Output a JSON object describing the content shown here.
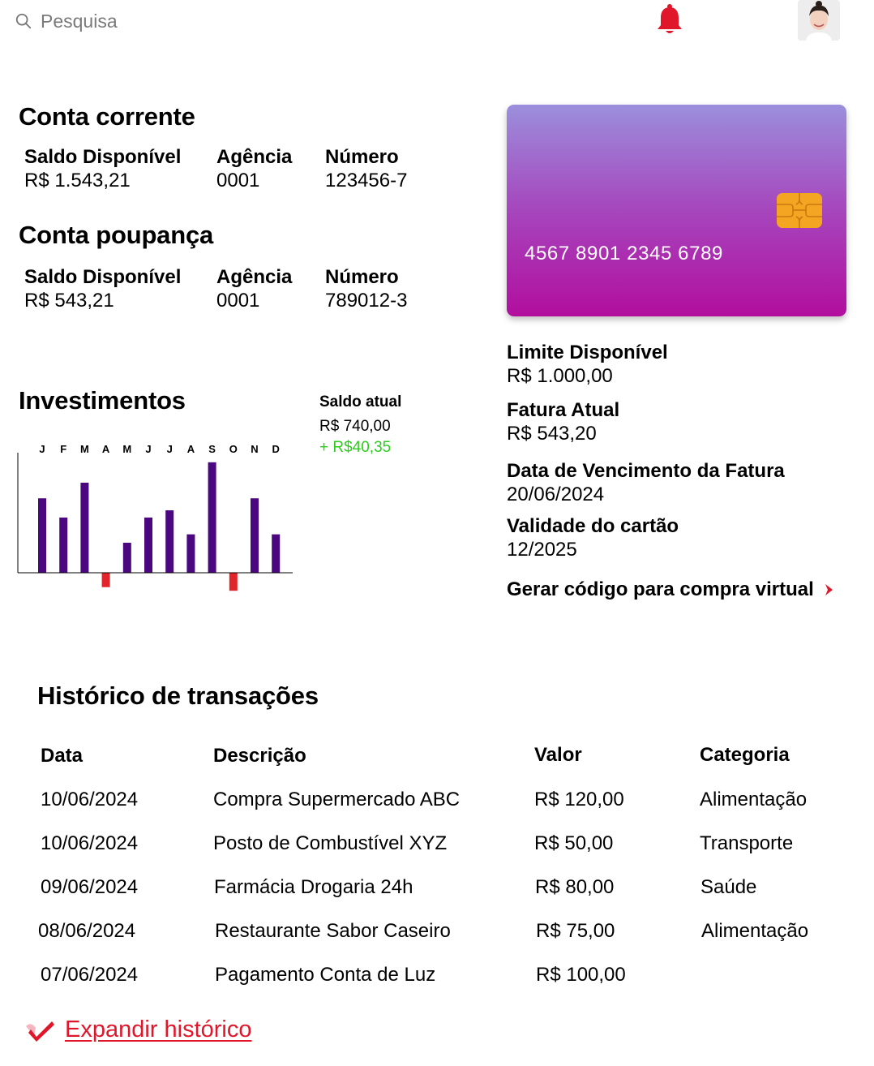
{
  "header": {
    "search_placeholder": "Pesquisa",
    "icons": {
      "search": "search-icon",
      "bell": "bell-icon",
      "avatar": "user-avatar"
    },
    "bell_color": "#e0162b"
  },
  "conta_corrente": {
    "title": "Conta corrente",
    "saldo_label": "Saldo Disponível",
    "saldo_value": "R$ 1.543,21",
    "agencia_label": "Agência",
    "agencia_value": "0001",
    "numero_label": "Número",
    "numero_value": "123456-7"
  },
  "conta_poupanca": {
    "title": "Conta poupança",
    "saldo_label": "Saldo Disponível",
    "saldo_value": "R$ 543,21",
    "agencia_label": "Agência",
    "agencia_value": "0001",
    "numero_label": "Número",
    "numero_value": "789012-3"
  },
  "investimentos": {
    "title": "Investimentos",
    "saldo_label": "Saldo atual",
    "saldo_value": "R$ 740,00",
    "variacao": "+ R$40,35",
    "positive_color": "#2bcc1a",
    "negative_color": "#e0262b",
    "bar_color": "#4b0780"
  },
  "chart_data": {
    "type": "bar",
    "categories": [
      "J",
      "F",
      "M",
      "A",
      "M",
      "J",
      "J",
      "A",
      "S",
      "O",
      "N",
      "D"
    ],
    "values": [
      62,
      46,
      75,
      -12,
      25,
      46,
      52,
      32,
      92,
      -15,
      62,
      32
    ],
    "title": "",
    "xlabel": "",
    "ylabel": "",
    "ylim": [
      -20,
      100
    ],
    "grid": false,
    "legend": "none"
  },
  "cartao": {
    "numero": "4567 8901 2345 6789",
    "limite_label": "Limite Disponível",
    "limite_value": "R$ 1.000,00",
    "fatura_label": "Fatura Atual",
    "fatura_value": "R$ 543,20",
    "vencimento_label": "Data de Vencimento da Fatura",
    "vencimento_value": "20/06/2024",
    "validade_label": "Validade do cartão",
    "validade_value": "12/2025",
    "gerar_codigo": "Gerar código para compra virtual",
    "chip_color": "#f4a522"
  },
  "historico": {
    "title": "Histórico de transações",
    "columns": [
      "Data",
      "Descrição",
      "Valor",
      "Categoria"
    ],
    "rows": [
      [
        "10/06/2024",
        "Compra Supermercado ABC",
        "R$ 120,00",
        "Alimentação"
      ],
      [
        "10/06/2024",
        "Posto de Combustível XYZ",
        "R$ 50,00",
        "Transporte"
      ],
      [
        "09/06/2024",
        "Farmácia Drogaria 24h",
        "R$ 80,00",
        "Saúde"
      ],
      [
        "08/06/2024",
        "Restaurante Sabor Caseiro",
        "R$ 75,00",
        "Alimentação"
      ],
      [
        "07/06/2024",
        "Pagamento Conta de Luz",
        "R$ 100,00",
        ""
      ]
    ],
    "expandir": "Expandir histórico",
    "accent_color": "#e0162b"
  }
}
